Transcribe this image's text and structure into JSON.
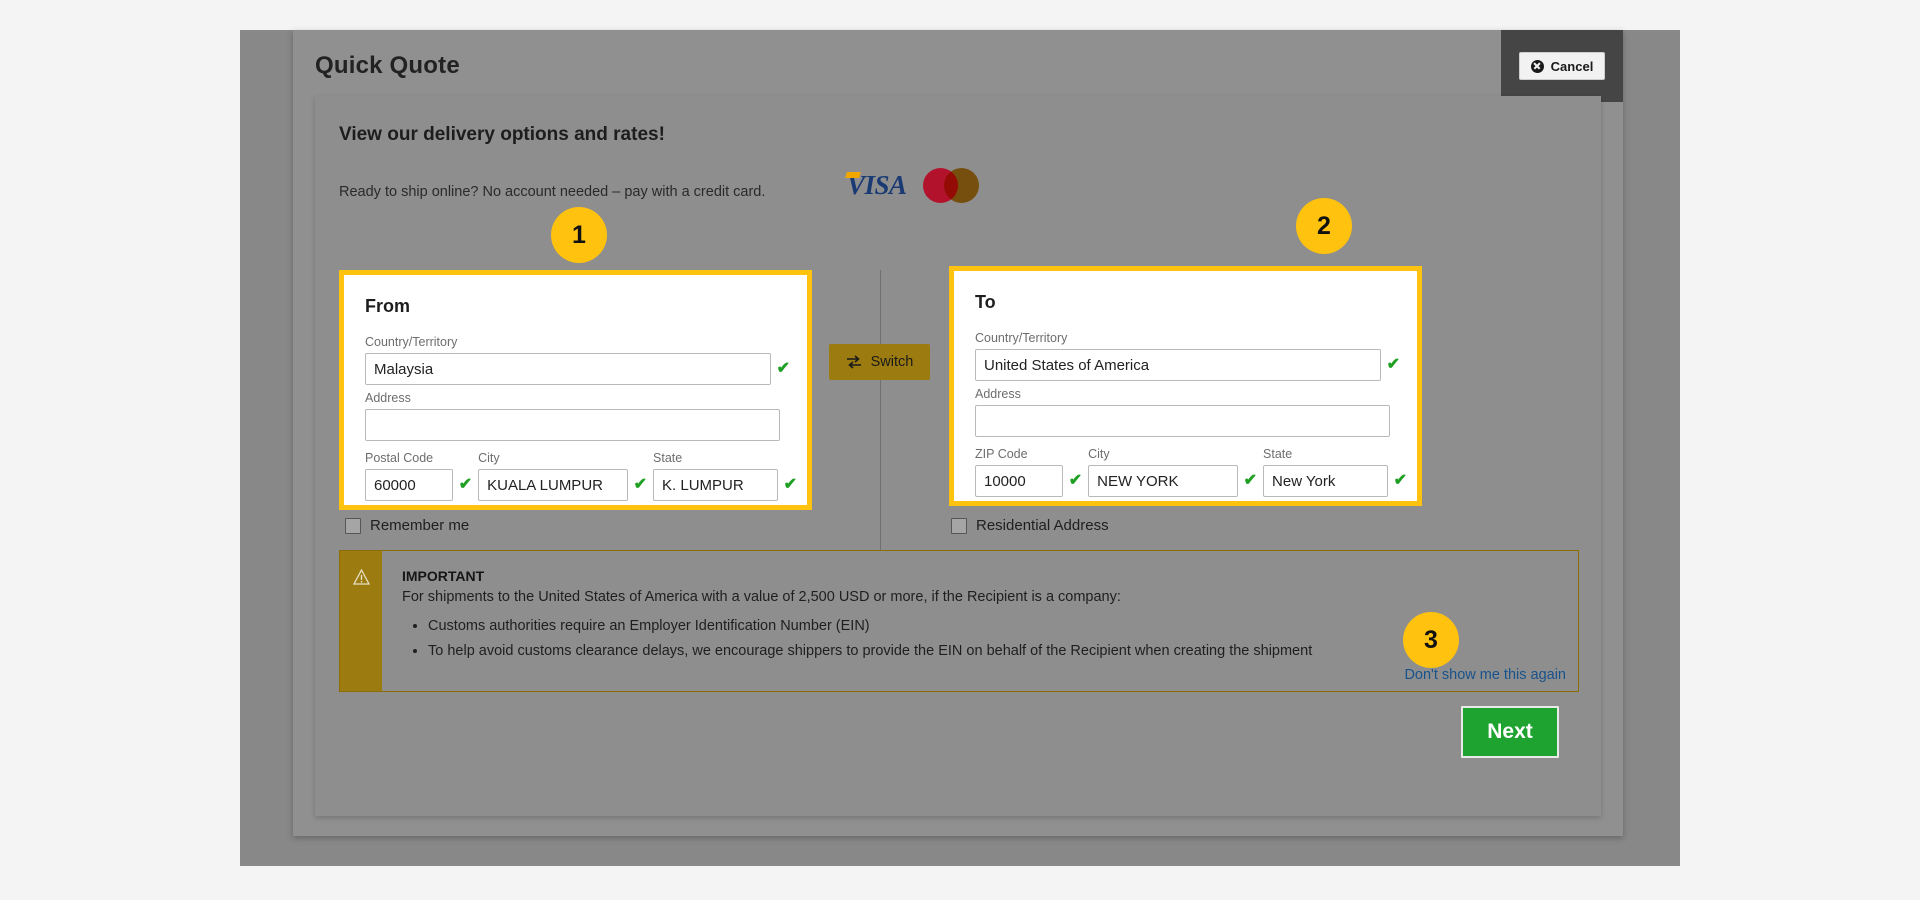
{
  "modal": {
    "title": "Quick Quote",
    "cancel_label": "Cancel"
  },
  "promo": {
    "heading": "View our delivery options and rates!",
    "subtext": "Ready to ship online? No account needed – pay with a credit card.",
    "cards": [
      {
        "name": "visa-logo",
        "text": "VISA"
      },
      {
        "name": "mastercard-logo",
        "text": ""
      }
    ]
  },
  "from": {
    "title": "From",
    "country_label": "Country/Territory",
    "country_value": "Malaysia",
    "address_label": "Address",
    "address_value": "",
    "postal_label": "Postal Code",
    "postal_value": "60000",
    "city_label": "City",
    "city_value": "KUALA LUMPUR",
    "state_label": "State",
    "state_value": "K. LUMPUR",
    "valid_mark": "✔"
  },
  "to": {
    "title": "To",
    "country_label": "Country/Territory",
    "country_value": "United States of America",
    "address_label": "Address",
    "address_value": "",
    "postal_label": "ZIP Code",
    "postal_value": "10000",
    "city_label": "City",
    "city_value": "NEW YORK",
    "state_label": "State",
    "state_value": "New York",
    "valid_mark": "✔"
  },
  "switch": {
    "label": "Switch"
  },
  "checkboxes": {
    "remember_me": "Remember me",
    "residential_address": "Residential Address"
  },
  "notice": {
    "title": "IMPORTANT",
    "lead": "For shipments to the United States of America with a value of 2,500 USD or more, if the Recipient is a company:",
    "bullets": [
      "Customs authorities require an Employer Identification Number (EIN)",
      "To help avoid customs clearance delays, we encourage shippers to provide the EIN on behalf of the Recipient when creating the shipment"
    ],
    "link": "Don't show me this again"
  },
  "footer": {
    "next_label": "Next"
  },
  "badges": {
    "one": "1",
    "two": "2",
    "three": "3"
  },
  "colors": {
    "accent_yellow": "#ffc20e",
    "switch_gold": "#9c7c10",
    "next_green": "#1ea331",
    "link_blue": "#19538c",
    "valid_green": "#1fa024",
    "modal_gray": "#909090"
  }
}
